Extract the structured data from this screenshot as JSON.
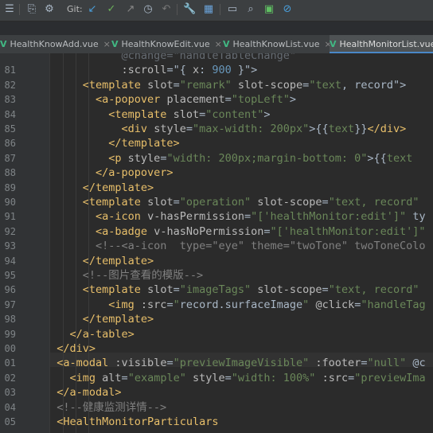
{
  "toolbar": {
    "git_label": "Git:",
    "icons": [
      "pull-icon",
      "commit-icon",
      "push-icon",
      "history-icon",
      "revert-icon",
      "settings-icon",
      "project-structure-icon",
      "terminal-icon",
      "search-icon",
      "vcs-icon",
      "no-icon"
    ]
  },
  "tabs": [
    {
      "label": "HealthKnowAdd.vue",
      "active": false
    },
    {
      "label": "HealthKnowEdit.vue",
      "active": false
    },
    {
      "label": "HealthKnowList.vue",
      "active": false
    },
    {
      "label": "HealthMonitorList.vue",
      "active": true
    }
  ],
  "editor": {
    "lines": [
      {
        "num": "",
        "tokens": [
          [
            "sy",
            "            @change=\"handleTableChange\""
          ]
        ],
        "dim": true
      },
      {
        "num": "81",
        "tokens": [
          [
            "sy",
            "            "
          ],
          [
            "at",
            ":scroll"
          ],
          [
            "sy",
            "=\"{ "
          ],
          [
            "at",
            "x"
          ],
          [
            "sy",
            ": "
          ],
          [
            "nu",
            "900"
          ],
          [
            "sy",
            " }\">"
          ]
        ]
      },
      {
        "num": "82",
        "tokens": [
          [
            "sy",
            "      "
          ],
          [
            "tg",
            "<template "
          ],
          [
            "at",
            "slot"
          ],
          [
            "sy",
            "="
          ],
          [
            "st",
            "\"remark\""
          ],
          [
            "sy",
            " "
          ],
          [
            "at",
            "slot-scope"
          ],
          [
            "sy",
            "="
          ],
          [
            "st",
            "\"text"
          ],
          [
            "sy",
            ", record\">"
          ]
        ]
      },
      {
        "num": "83",
        "tokens": [
          [
            "sy",
            "        "
          ],
          [
            "tg",
            "<a-popover "
          ],
          [
            "at",
            "placement"
          ],
          [
            "sy",
            "="
          ],
          [
            "st",
            "\"topLeft\""
          ],
          [
            "sy",
            ">"
          ]
        ]
      },
      {
        "num": "84",
        "tokens": [
          [
            "sy",
            "          "
          ],
          [
            "tg",
            "<template "
          ],
          [
            "at",
            "slot"
          ],
          [
            "sy",
            "="
          ],
          [
            "st",
            "\"content\""
          ],
          [
            "sy",
            ">"
          ]
        ]
      },
      {
        "num": "85",
        "tokens": [
          [
            "sy",
            "            "
          ],
          [
            "tg",
            "<div "
          ],
          [
            "at",
            "style"
          ],
          [
            "sy",
            "="
          ],
          [
            "st",
            "\"max-width: 200px\""
          ],
          [
            "sy",
            ">{{"
          ],
          [
            "st",
            "text"
          ],
          [
            "sy",
            "}}"
          ],
          [
            "tg",
            "</div>"
          ]
        ]
      },
      {
        "num": "86",
        "tokens": [
          [
            "sy",
            "          "
          ],
          [
            "tg",
            "</template>"
          ]
        ]
      },
      {
        "num": "87",
        "tokens": [
          [
            "sy",
            "          "
          ],
          [
            "tg",
            "<p "
          ],
          [
            "at",
            "style"
          ],
          [
            "sy",
            "="
          ],
          [
            "st",
            "\"width: 200px;margin-bottom: 0\""
          ],
          [
            "sy",
            ">{{"
          ],
          [
            "st",
            "text"
          ]
        ]
      },
      {
        "num": "88",
        "tokens": [
          [
            "sy",
            "        "
          ],
          [
            "tg",
            "</a-popover>"
          ]
        ]
      },
      {
        "num": "89",
        "tokens": [
          [
            "sy",
            "      "
          ],
          [
            "tg",
            "</template>"
          ]
        ]
      },
      {
        "num": "90",
        "tokens": [
          [
            "sy",
            "      "
          ],
          [
            "tg",
            "<template "
          ],
          [
            "at",
            "slot"
          ],
          [
            "sy",
            "="
          ],
          [
            "st",
            "\"operation\""
          ],
          [
            "sy",
            " "
          ],
          [
            "at",
            "slot-scope"
          ],
          [
            "sy",
            "="
          ],
          [
            "st",
            "\"text, record\""
          ]
        ]
      },
      {
        "num": "91",
        "tokens": [
          [
            "sy",
            "        "
          ],
          [
            "tg",
            "<a-icon "
          ],
          [
            "at",
            "v-hasPermission"
          ],
          [
            "sy",
            "="
          ],
          [
            "st",
            "\"['healthMonitor:edit']\""
          ],
          [
            "sy",
            " ty"
          ]
        ]
      },
      {
        "num": "92",
        "tokens": [
          [
            "sy",
            "        "
          ],
          [
            "tg",
            "<a-badge "
          ],
          [
            "at",
            "v-hasNoPermission"
          ],
          [
            "sy",
            "="
          ],
          [
            "st",
            "\"['healthMonitor:edit']\""
          ]
        ]
      },
      {
        "num": "93",
        "tokens": [
          [
            "sy",
            "        "
          ],
          [
            "cm",
            "<!--<a-icon  type=\"eye\" theme=\"twoTone\" twoToneColo"
          ]
        ]
      },
      {
        "num": "94",
        "tokens": [
          [
            "sy",
            "      "
          ],
          [
            "tg",
            "</template>"
          ]
        ]
      },
      {
        "num": "95",
        "tokens": [
          [
            "sy",
            "      "
          ],
          [
            "cm",
            "<!--图片查看的模版-->"
          ]
        ]
      },
      {
        "num": "96",
        "tokens": [
          [
            "sy",
            "      "
          ],
          [
            "tg",
            "<template "
          ],
          [
            "at",
            "slot"
          ],
          [
            "sy",
            "="
          ],
          [
            "st",
            "\"imageTags\""
          ],
          [
            "sy",
            " "
          ],
          [
            "at",
            "slot-scope"
          ],
          [
            "sy",
            "="
          ],
          [
            "st",
            "\"text, record\""
          ]
        ]
      },
      {
        "num": "97",
        "tokens": [
          [
            "sy",
            "          "
          ],
          [
            "tg",
            "<img "
          ],
          [
            "at",
            ":src"
          ],
          [
            "sy",
            "="
          ],
          [
            "st",
            "\""
          ],
          [
            "sy",
            "record.surfaceImage"
          ],
          [
            "st",
            "\""
          ],
          [
            "sy",
            " "
          ],
          [
            "at",
            "@click"
          ],
          [
            "sy",
            "="
          ],
          [
            "st",
            "\"handleTag"
          ]
        ]
      },
      {
        "num": "98",
        "tokens": [
          [
            "sy",
            "      "
          ],
          [
            "tg",
            "</template>"
          ]
        ]
      },
      {
        "num": "99",
        "tokens": [
          [
            "sy",
            "    "
          ],
          [
            "tg",
            "</a-table>"
          ]
        ]
      },
      {
        "num": "00",
        "tokens": [
          [
            "sy",
            "  "
          ],
          [
            "tg",
            "</div>"
          ]
        ]
      },
      {
        "num": "01",
        "tokens": [
          [
            "sy",
            "  "
          ],
          [
            "tg",
            "<a-modal "
          ],
          [
            "at",
            ":visible"
          ],
          [
            "sy",
            "="
          ],
          [
            "st",
            "\"previewImageVisible\""
          ],
          [
            "sy",
            " "
          ],
          [
            "at",
            ":footer"
          ],
          [
            "sy",
            "="
          ],
          [
            "st",
            "\"null\""
          ],
          [
            "sy",
            " @c"
          ]
        ]
      },
      {
        "num": "02",
        "tokens": [
          [
            "sy",
            "    "
          ],
          [
            "tg",
            "<img "
          ],
          [
            "at",
            "alt"
          ],
          [
            "sy",
            "="
          ],
          [
            "st",
            "\"example\""
          ],
          [
            "sy",
            " "
          ],
          [
            "at",
            "style"
          ],
          [
            "sy",
            "="
          ],
          [
            "st",
            "\"width: 100%\""
          ],
          [
            "sy",
            " "
          ],
          [
            "at",
            ":src"
          ],
          [
            "sy",
            "="
          ],
          [
            "st",
            "\"previewIma"
          ]
        ]
      },
      {
        "num": "03",
        "tokens": [
          [
            "sy",
            "  "
          ],
          [
            "tg",
            "</a-modal>"
          ]
        ]
      },
      {
        "num": "04",
        "tokens": [
          [
            "sy",
            "  "
          ],
          [
            "cm",
            "<!--健康监测详情-->"
          ]
        ]
      },
      {
        "num": "05",
        "tokens": [
          [
            "sy",
            "  "
          ],
          [
            "tg",
            "<HealthMonitorParticulars"
          ]
        ]
      }
    ]
  }
}
